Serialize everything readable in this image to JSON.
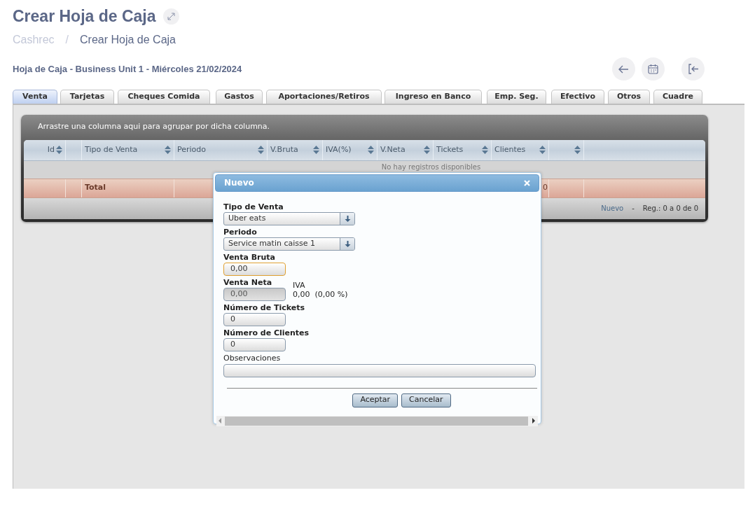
{
  "page": {
    "title": "Crear Hoja de Caja",
    "breadcrumb": [
      "Cashrec",
      "Crear Hoja de Caja"
    ],
    "breadcrumb_separator": "/",
    "subtitle": "Hoja de Caja - Business Unit 1 - Miércoles 21/02/2024"
  },
  "tabs": [
    {
      "label": "Venta",
      "selected": true
    },
    {
      "label": "Tarjetas",
      "selected": false
    },
    {
      "label": "Cheques Comida",
      "selected": false
    },
    {
      "label": "Gastos",
      "selected": false
    },
    {
      "label": "Aportaciones/Retiros",
      "selected": false
    },
    {
      "label": "Ingreso en Banco",
      "selected": false
    },
    {
      "label": "Emp. Seg.",
      "selected": false
    },
    {
      "label": "Efectivo",
      "selected": false
    },
    {
      "label": "Otros",
      "selected": false
    },
    {
      "label": "Cuadre",
      "selected": false
    }
  ],
  "grid": {
    "group_hint": "Arrastre una columna aqui para agrupar por dicha columna.",
    "columns": [
      {
        "label": "Id",
        "sortable": true
      },
      {
        "sortable": false
      },
      {
        "label": "Tipo de Venta",
        "sortable": true
      },
      {
        "label": "Periodo",
        "sortable": true
      },
      {
        "label": "V.Bruta",
        "sortable": true
      },
      {
        "label": "IVA(%)",
        "sortable": true
      },
      {
        "label": "V.Neta",
        "sortable": true
      },
      {
        "label": "Tickets",
        "sortable": true
      },
      {
        "label": "Clientes",
        "sortable": true
      },
      {
        "sortable": true
      }
    ],
    "empty_message": "No hay registros disponibles",
    "total_row": {
      "label": "Total",
      "clientes": "0"
    },
    "footer": {
      "new_link": "Nuevo",
      "separator": "-",
      "records": "Reg.: 0 a 0 de 0"
    }
  },
  "dialog": {
    "title": "Nuevo",
    "fields": [
      {
        "kind": "select",
        "label": "Tipo de Venta",
        "value": "Uber eats"
      },
      {
        "kind": "select",
        "label": "Periodo",
        "value": "Service matin caisse 1"
      },
      {
        "kind": "input",
        "label": "Venta Bruta",
        "value": "0,00",
        "focused": true,
        "disabled": false
      },
      {
        "kind": "input",
        "label": "Venta Neta",
        "value": "0,00",
        "focused": false,
        "disabled": true,
        "aside": {
          "label": "IVA",
          "value": "0,00  (0,00 %)"
        }
      },
      {
        "kind": "input",
        "label": "Número de Tickets",
        "value": "0",
        "focused": false,
        "disabled": false
      },
      {
        "kind": "input",
        "label": "Número de Clientes",
        "value": "0",
        "focused": false,
        "disabled": false
      },
      {
        "kind": "wide",
        "label": "Observaciones"
      }
    ],
    "buttons": [
      "Aceptar",
      "Cancelar"
    ]
  }
}
